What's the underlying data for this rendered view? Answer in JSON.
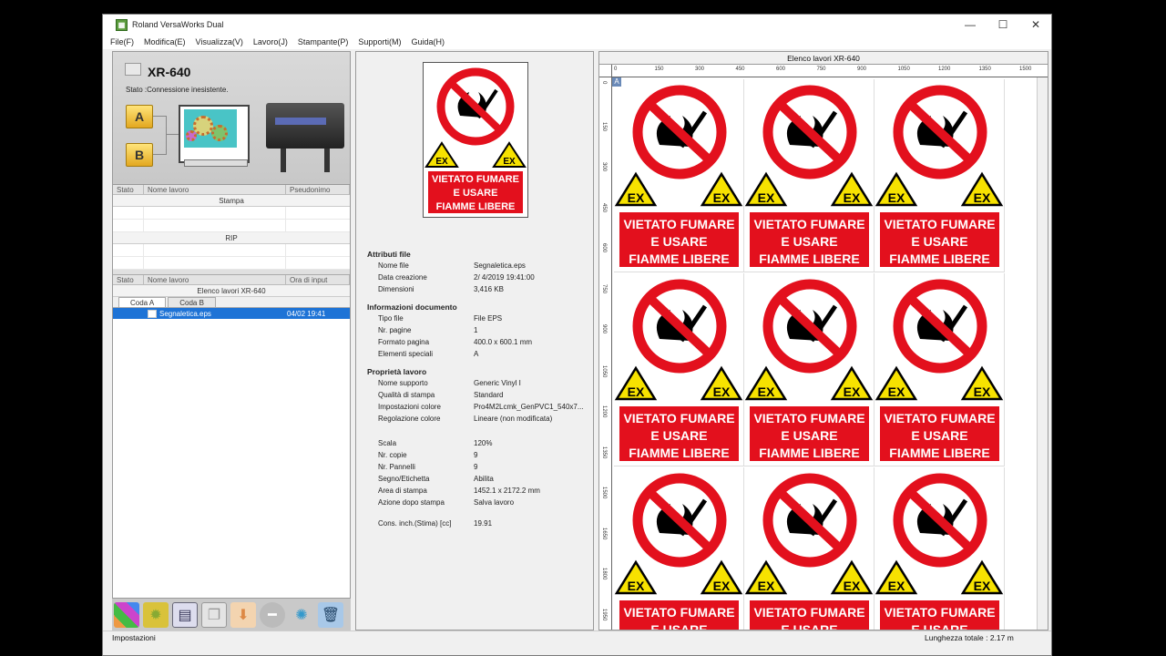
{
  "window": {
    "title": "Roland VersaWorks Dual",
    "controls": {
      "minimize": "—",
      "maximize": "☐",
      "close": "✕"
    }
  },
  "menu": [
    "File(F)",
    "Modifica(E)",
    "Visualizza(V)",
    "Lavoro(J)",
    "Stampante(P)",
    "Supporti(M)",
    "Guida(H)"
  ],
  "printer": {
    "name": "XR-640",
    "state": "Stato :Connessione inesistente.",
    "folders": [
      "A",
      "B"
    ]
  },
  "queue_columns": [
    "Stato",
    "Nome lavoro",
    "Pseudonimo"
  ],
  "sections": {
    "print": "Stampa",
    "rip": "RIP"
  },
  "list_columns": [
    "Stato",
    "Nome lavoro",
    "Ora di input"
  ],
  "job_list": {
    "title": "Elenco lavori XR-640",
    "tabs": [
      "Coda A",
      "Coda B"
    ],
    "jobs": [
      {
        "name": "Segnaletica.eps",
        "time": "04/02 19:41"
      }
    ]
  },
  "sign": {
    "badge": "EX",
    "line1": "VIETATO FUMARE",
    "line2": "E USARE",
    "line3": "FIAMME LIBERE"
  },
  "attributes": {
    "file_header": "Attributi file",
    "file": [
      [
        "Nome file",
        "Segnaletica.eps"
      ],
      [
        "Data creazione",
        " 2/ 4/2019 19:41:00"
      ],
      [
        "Dimensioni",
        "3,416 KB"
      ]
    ],
    "doc_header": "Informazioni documento",
    "doc": [
      [
        "Tipo file",
        "File EPS"
      ],
      [
        "Nr. pagine",
        "1"
      ],
      [
        "Formato pagina",
        "400.0 x 600.1 mm"
      ],
      [
        "Elementi speciali",
        "A"
      ]
    ],
    "job_header": "Proprietà lavoro",
    "job": [
      [
        "Nome supporto",
        "Generic Vinyl I"
      ],
      [
        "Qualità di stampa",
        "Standard"
      ],
      [
        "Impostazioni colore",
        "Pro4M2Lcmk_GenPVC1_540x7..."
      ],
      [
        "Regolazione colore",
        "Lineare (non modificata)"
      ]
    ],
    "job2": [
      [
        "Scala",
        "120%"
      ],
      [
        "Nr. copie",
        "9"
      ],
      [
        "Nr. Pannelli",
        "9"
      ],
      [
        "Segno/Etichetta",
        "Abilita"
      ],
      [
        "Area di stampa",
        "1452.1 x 2172.2 mm"
      ],
      [
        "Azione dopo stampa",
        "Salva lavoro"
      ]
    ],
    "ink": [
      [
        "Cons. inch.(Stima) [cc]",
        "19.91"
      ]
    ]
  },
  "layout_view": {
    "title": "Elenco lavori XR-640",
    "ruler_h": [
      "0",
      "150",
      "300",
      "450",
      "600",
      "750",
      "900",
      "1050",
      "1200",
      "1350",
      "1500"
    ],
    "ruler_v": [
      "0",
      "150",
      "300",
      "450",
      "600",
      "750",
      "900",
      "1050",
      "1200",
      "1350",
      "1500",
      "1650",
      "1800",
      "1950"
    ],
    "marker": "A"
  },
  "status_bar": {
    "left": "Impostazioni",
    "right": "Lunghezza totale : 2.17 m"
  },
  "toolbar": [
    "settings-icon",
    "gear-icon",
    "print-icon",
    "copy-icon",
    "import-icon",
    "stop-icon",
    "loading-icon",
    "trash-icon"
  ],
  "colors": {
    "sign_red": "#e3101d",
    "warning_yellow": "#f7e200",
    "selection": "#1e73d6"
  }
}
